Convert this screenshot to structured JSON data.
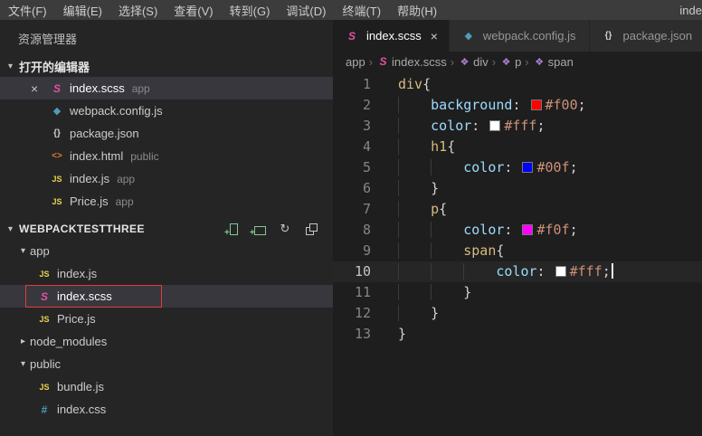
{
  "window": {
    "title_fragment": "inde"
  },
  "menu": {
    "items": [
      {
        "key": "file",
        "label": "文件(F)"
      },
      {
        "key": "edit",
        "label": "编辑(E)"
      },
      {
        "key": "selection",
        "label": "选择(S)"
      },
      {
        "key": "view",
        "label": "查看(V)"
      },
      {
        "key": "goto",
        "label": "转到(G)"
      },
      {
        "key": "debug",
        "label": "调试(D)"
      },
      {
        "key": "terminal",
        "label": "终端(T)"
      },
      {
        "key": "help",
        "label": "帮助(H)"
      }
    ]
  },
  "sidebar": {
    "title": "资源管理器",
    "open_editors": {
      "label": "打开的编辑器",
      "items": [
        {
          "icon": "scss",
          "name": "index.scss",
          "badge": "app",
          "active": true
        },
        {
          "icon": "webpack",
          "name": "webpack.config.js",
          "badge": "",
          "active": false
        },
        {
          "icon": "json",
          "name": "package.json",
          "badge": "",
          "active": false
        },
        {
          "icon": "html",
          "name": "index.html",
          "badge": "public",
          "active": false
        },
        {
          "icon": "js",
          "name": "index.js",
          "badge": "app",
          "active": false
        },
        {
          "icon": "js",
          "name": "Price.js",
          "badge": "app",
          "active": false
        }
      ]
    },
    "workspace": {
      "label": "WEBPACKTESTTHREE",
      "actions": [
        "new-file",
        "new-folder",
        "refresh",
        "collapse-all"
      ],
      "items": [
        {
          "kind": "folder",
          "name": "app",
          "expanded": true,
          "depth": 0
        },
        {
          "kind": "file",
          "icon": "js",
          "name": "index.js",
          "depth": 1
        },
        {
          "kind": "file",
          "icon": "scss",
          "name": "index.scss",
          "depth": 1,
          "selected": true,
          "annotated": true
        },
        {
          "kind": "file",
          "icon": "js",
          "name": "Price.js",
          "depth": 1
        },
        {
          "kind": "folder",
          "name": "node_modules",
          "expanded": false,
          "depth": 0
        },
        {
          "kind": "folder",
          "name": "public",
          "expanded": true,
          "depth": 0
        },
        {
          "kind": "file",
          "icon": "js",
          "name": "bundle.js",
          "depth": 1
        },
        {
          "kind": "file",
          "icon": "css",
          "name": "index.css",
          "depth": 1
        }
      ]
    }
  },
  "editor": {
    "tabs": [
      {
        "icon": "scss",
        "label": "index.scss",
        "active": true,
        "closable": true
      },
      {
        "icon": "webpack",
        "label": "webpack.config.js",
        "active": false
      },
      {
        "icon": "json",
        "label": "package.json",
        "active": false,
        "clipped": true
      }
    ],
    "breadcrumbs": [
      {
        "label": "app"
      },
      {
        "icon": "scss",
        "label": "index.scss"
      },
      {
        "icon": "symbol",
        "label": "div"
      },
      {
        "icon": "symbol",
        "label": "p"
      },
      {
        "icon": "symbol",
        "label": "span"
      }
    ],
    "colors": {
      "selector": "#d7ba7d",
      "property": "#9cdcfe",
      "punctuation": "#d4d4d4",
      "value": "#ce9178"
    },
    "code": {
      "lines": [
        {
          "n": 1,
          "tokens": [
            {
              "t": "div",
              "c": "sel"
            },
            {
              "t": "{",
              "c": "punc"
            }
          ]
        },
        {
          "n": 2,
          "tokens": [
            {
              "t": "    ",
              "c": "ws"
            },
            {
              "t": "background",
              "c": "prop"
            },
            {
              "t": ": ",
              "c": "punc"
            },
            {
              "sw": "#f00"
            },
            {
              "t": "#f00",
              "c": "val"
            },
            {
              "t": ";",
              "c": "punc"
            }
          ]
        },
        {
          "n": 3,
          "tokens": [
            {
              "t": "    ",
              "c": "ws"
            },
            {
              "t": "color",
              "c": "prop"
            },
            {
              "t": ": ",
              "c": "punc"
            },
            {
              "sw": "#fff"
            },
            {
              "t": "#fff",
              "c": "val"
            },
            {
              "t": ";",
              "c": "punc"
            }
          ]
        },
        {
          "n": 4,
          "tokens": [
            {
              "t": "    ",
              "c": "ws"
            },
            {
              "t": "h1",
              "c": "sel"
            },
            {
              "t": "{",
              "c": "punc"
            }
          ]
        },
        {
          "n": 5,
          "tokens": [
            {
              "t": "    ",
              "c": "ws"
            },
            {
              "t": "    ",
              "c": "ws"
            },
            {
              "t": "color",
              "c": "prop"
            },
            {
              "t": ": ",
              "c": "punc"
            },
            {
              "sw": "#00f"
            },
            {
              "t": "#00f",
              "c": "val"
            },
            {
              "t": ";",
              "c": "punc"
            }
          ]
        },
        {
          "n": 6,
          "tokens": [
            {
              "t": "    ",
              "c": "ws"
            },
            {
              "t": "}",
              "c": "punc"
            }
          ]
        },
        {
          "n": 7,
          "tokens": [
            {
              "t": "    ",
              "c": "ws"
            },
            {
              "t": "p",
              "c": "sel"
            },
            {
              "t": "{",
              "c": "punc"
            }
          ]
        },
        {
          "n": 8,
          "tokens": [
            {
              "t": "    ",
              "c": "ws"
            },
            {
              "t": "    ",
              "c": "ws"
            },
            {
              "t": "color",
              "c": "prop"
            },
            {
              "t": ": ",
              "c": "punc"
            },
            {
              "sw": "#f0f"
            },
            {
              "t": "#f0f",
              "c": "val"
            },
            {
              "t": ";",
              "c": "punc"
            }
          ]
        },
        {
          "n": 9,
          "tokens": [
            {
              "t": "    ",
              "c": "ws"
            },
            {
              "t": "    ",
              "c": "ws"
            },
            {
              "t": "span",
              "c": "sel"
            },
            {
              "t": "{",
              "c": "punc"
            }
          ]
        },
        {
          "n": 10,
          "active": true,
          "tokens": [
            {
              "t": "    ",
              "c": "ws"
            },
            {
              "t": "    ",
              "c": "ws"
            },
            {
              "t": "    ",
              "c": "ws"
            },
            {
              "t": "color",
              "c": "prop"
            },
            {
              "t": ": ",
              "c": "punc"
            },
            {
              "sw": "#fff"
            },
            {
              "t": "#fff",
              "c": "val"
            },
            {
              "t": ";",
              "c": "punc"
            },
            {
              "cursor": true
            }
          ]
        },
        {
          "n": 11,
          "tokens": [
            {
              "t": "    ",
              "c": "ws"
            },
            {
              "t": "    ",
              "c": "ws"
            },
            {
              "t": "}",
              "c": "punc"
            }
          ]
        },
        {
          "n": 12,
          "tokens": [
            {
              "t": "    ",
              "c": "ws"
            },
            {
              "t": "}",
              "c": "punc"
            }
          ]
        },
        {
          "n": 13,
          "tokens": [
            {
              "t": "}",
              "c": "punc"
            }
          ]
        }
      ]
    }
  }
}
